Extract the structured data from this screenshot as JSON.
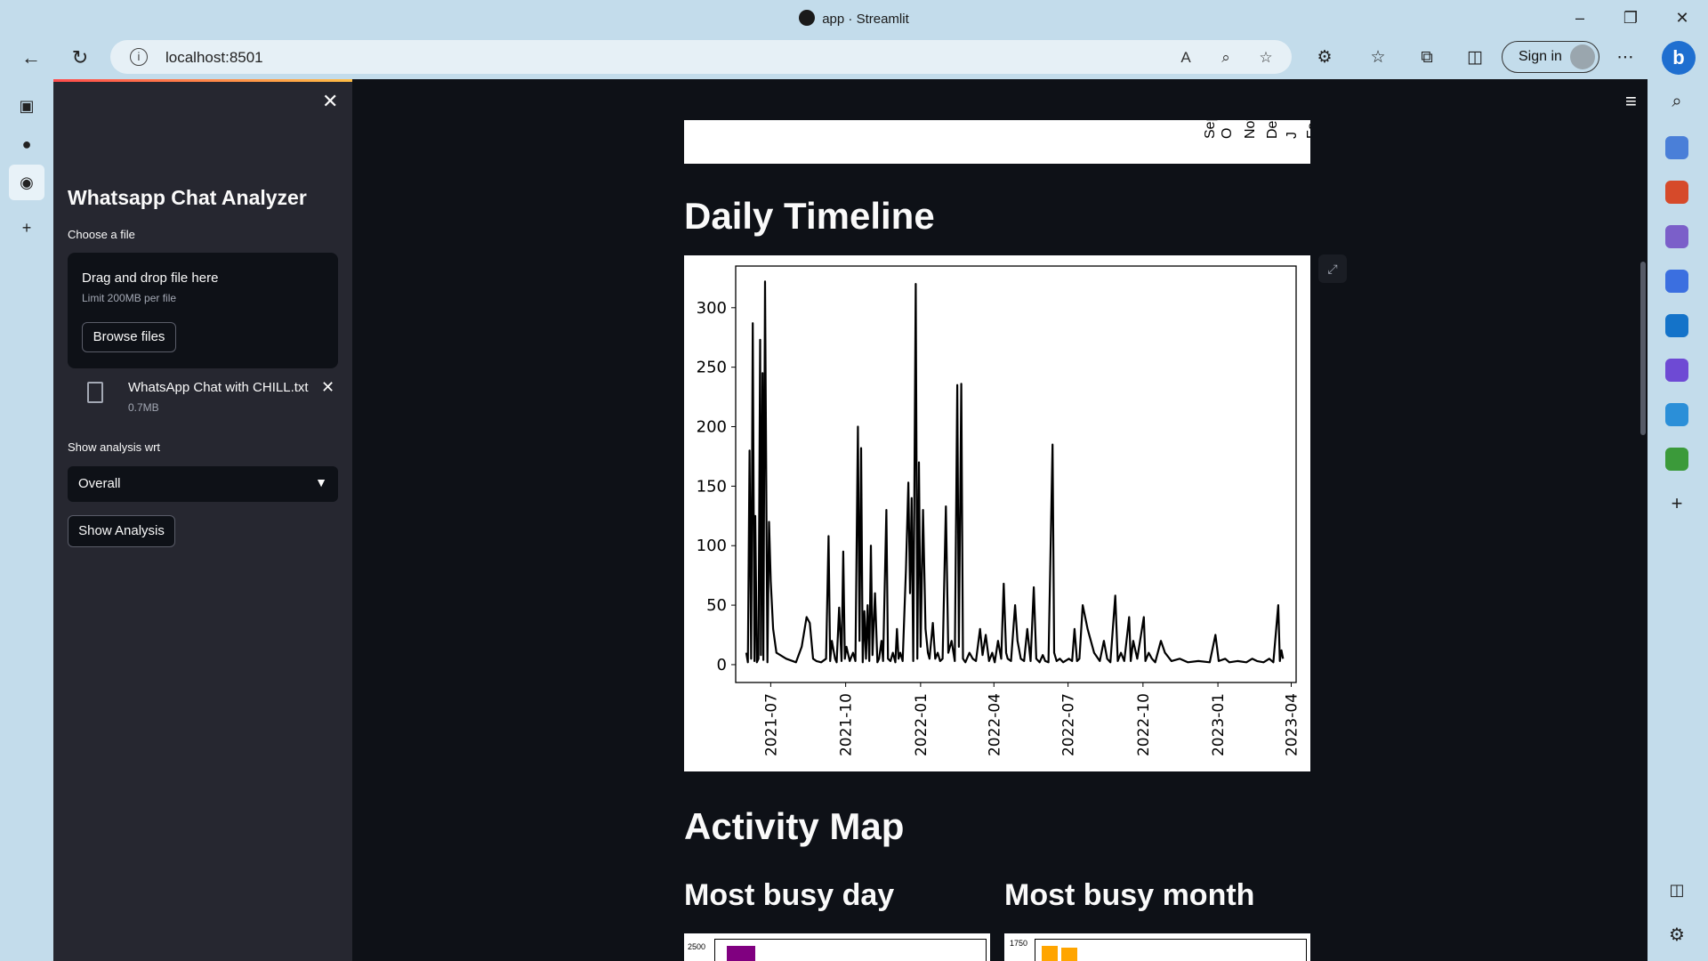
{
  "window": {
    "title": "app · Streamlit"
  },
  "browser": {
    "url": "localhost:8501",
    "signin_label": "Sign in",
    "bing": "b"
  },
  "sidebar": {
    "title": "Whatsapp Chat Analyzer",
    "file_label": "Choose a file",
    "drop_text": "Drag and drop file here",
    "limit_text": "Limit 200MB per file",
    "browse_label": "Browse files",
    "file_name": "WhatsApp Chat with CHILL.txt",
    "file_size": "0.7MB",
    "analysis_label": "Show analysis wrt",
    "analysis_value": "Overall",
    "show_button": "Show Analysis"
  },
  "main": {
    "daily_heading": "Daily Timeline",
    "activity_heading": "Activity Map",
    "busy_day_heading": "Most busy day",
    "busy_month_heading": "Most busy month",
    "monthly_ticks": [
      "Sept",
      "O",
      "Nov",
      "Dec",
      "J",
      "Fe"
    ],
    "busy_day_top_tick": "2500",
    "busy_month_top_tick": "1750"
  },
  "chart_data": [
    {
      "type": "line",
      "title": "",
      "xlabel": "",
      "ylabel": "",
      "ylim": [
        -15,
        335
      ],
      "xlim": [
        "2021-05-19",
        "2023-04-07"
      ],
      "yticks": [
        0,
        50,
        100,
        150,
        200,
        250,
        300
      ],
      "xticks": [
        "2021-07",
        "2021-10",
        "2022-01",
        "2022-04",
        "2022-07",
        "2022-10",
        "2023-01",
        "2023-04"
      ],
      "color": "#000000",
      "series": [
        {
          "points": [
            [
              "2021-06-01",
              10
            ],
            [
              "2021-06-03",
              2
            ],
            [
              "2021-06-05",
              180
            ],
            [
              "2021-06-07",
              5
            ],
            [
              "2021-06-09",
              287
            ],
            [
              "2021-06-11",
              3
            ],
            [
              "2021-06-12",
              125
            ],
            [
              "2021-06-14",
              2
            ],
            [
              "2021-06-16",
              5
            ],
            [
              "2021-06-18",
              273
            ],
            [
              "2021-06-19",
              8
            ],
            [
              "2021-06-21",
              245
            ],
            [
              "2021-06-22",
              4
            ],
            [
              "2021-06-24",
              322
            ],
            [
              "2021-06-26",
              100
            ],
            [
              "2021-06-27",
              2
            ],
            [
              "2021-06-29",
              120
            ],
            [
              "2021-07-01",
              70
            ],
            [
              "2021-07-04",
              30
            ],
            [
              "2021-07-08",
              10
            ],
            [
              "2021-07-20",
              5
            ],
            [
              "2021-08-01",
              2
            ],
            [
              "2021-08-08",
              15
            ],
            [
              "2021-08-14",
              40
            ],
            [
              "2021-08-18",
              35
            ],
            [
              "2021-08-22",
              5
            ],
            [
              "2021-08-26",
              3
            ],
            [
              "2021-09-01",
              2
            ],
            [
              "2021-09-07",
              5
            ],
            [
              "2021-09-10",
              108
            ],
            [
              "2021-09-12",
              3
            ],
            [
              "2021-09-14",
              20
            ],
            [
              "2021-09-18",
              5
            ],
            [
              "2021-09-20",
              2
            ],
            [
              "2021-09-23",
              48
            ],
            [
              "2021-09-26",
              3
            ],
            [
              "2021-09-28",
              95
            ],
            [
              "2021-09-30",
              5
            ],
            [
              "2021-10-02",
              15
            ],
            [
              "2021-10-06",
              3
            ],
            [
              "2021-10-10",
              10
            ],
            [
              "2021-10-13",
              3
            ],
            [
              "2021-10-16",
              200
            ],
            [
              "2021-10-18",
              20
            ],
            [
              "2021-10-20",
              182
            ],
            [
              "2021-10-22",
              2
            ],
            [
              "2021-10-24",
              45
            ],
            [
              "2021-10-26",
              5
            ],
            [
              "2021-10-28",
              50
            ],
            [
              "2021-10-30",
              3
            ],
            [
              "2021-11-01",
              100
            ],
            [
              "2021-11-03",
              8
            ],
            [
              "2021-11-06",
              60
            ],
            [
              "2021-11-09",
              2
            ],
            [
              "2021-11-11",
              5
            ],
            [
              "2021-11-14",
              20
            ],
            [
              "2021-11-16",
              3
            ],
            [
              "2021-11-20",
              130
            ],
            [
              "2021-11-22",
              5
            ],
            [
              "2021-11-25",
              3
            ],
            [
              "2021-11-28",
              10
            ],
            [
              "2021-12-01",
              2
            ],
            [
              "2021-12-03",
              30
            ],
            [
              "2021-12-05",
              5
            ],
            [
              "2021-12-07",
              10
            ],
            [
              "2021-12-10",
              3
            ],
            [
              "2021-12-14",
              80
            ],
            [
              "2021-12-17",
              153
            ],
            [
              "2021-12-19",
              60
            ],
            [
              "2021-12-21",
              140
            ],
            [
              "2021-12-23",
              3
            ],
            [
              "2021-12-26",
              320
            ],
            [
              "2021-12-28",
              5
            ],
            [
              "2021-12-30",
              170
            ],
            [
              "2022-01-01",
              15
            ],
            [
              "2022-01-04",
              130
            ],
            [
              "2022-01-07",
              30
            ],
            [
              "2022-01-10",
              10
            ],
            [
              "2022-01-12",
              5
            ],
            [
              "2022-01-16",
              35
            ],
            [
              "2022-01-19",
              5
            ],
            [
              "2022-01-22",
              10
            ],
            [
              "2022-01-25",
              3
            ],
            [
              "2022-01-28",
              5
            ],
            [
              "2022-02-01",
              133
            ],
            [
              "2022-02-04",
              10
            ],
            [
              "2022-02-08",
              20
            ],
            [
              "2022-02-12",
              3
            ],
            [
              "2022-02-15",
              235
            ],
            [
              "2022-02-17",
              15
            ],
            [
              "2022-02-20",
              236
            ],
            [
              "2022-02-22",
              5
            ],
            [
              "2022-02-25",
              2
            ],
            [
              "2022-03-02",
              10
            ],
            [
              "2022-03-06",
              5
            ],
            [
              "2022-03-10",
              3
            ],
            [
              "2022-03-15",
              30
            ],
            [
              "2022-03-18",
              8
            ],
            [
              "2022-03-22",
              25
            ],
            [
              "2022-03-26",
              3
            ],
            [
              "2022-03-30",
              10
            ],
            [
              "2022-04-02",
              2
            ],
            [
              "2022-04-06",
              20
            ],
            [
              "2022-04-10",
              5
            ],
            [
              "2022-04-13",
              68
            ],
            [
              "2022-04-16",
              10
            ],
            [
              "2022-04-18",
              5
            ],
            [
              "2022-04-22",
              3
            ],
            [
              "2022-04-27",
              50
            ],
            [
              "2022-04-30",
              20
            ],
            [
              "2022-05-04",
              5
            ],
            [
              "2022-05-08",
              3
            ],
            [
              "2022-05-12",
              30
            ],
            [
              "2022-05-16",
              3
            ],
            [
              "2022-05-20",
              65
            ],
            [
              "2022-05-23",
              5
            ],
            [
              "2022-05-27",
              2
            ],
            [
              "2022-05-31",
              8
            ],
            [
              "2022-06-03",
              3
            ],
            [
              "2022-06-07",
              2
            ],
            [
              "2022-06-12",
              185
            ],
            [
              "2022-06-14",
              10
            ],
            [
              "2022-06-17",
              3
            ],
            [
              "2022-06-21",
              5
            ],
            [
              "2022-06-25",
              2
            ],
            [
              "2022-07-02",
              5
            ],
            [
              "2022-07-06",
              3
            ],
            [
              "2022-07-09",
              30
            ],
            [
              "2022-07-12",
              3
            ],
            [
              "2022-07-15",
              5
            ],
            [
              "2022-07-19",
              50
            ],
            [
              "2022-07-25",
              30
            ],
            [
              "2022-08-02",
              10
            ],
            [
              "2022-08-09",
              3
            ],
            [
              "2022-08-14",
              20
            ],
            [
              "2022-08-18",
              5
            ],
            [
              "2022-08-22",
              2
            ],
            [
              "2022-08-28",
              58
            ],
            [
              "2022-08-31",
              3
            ],
            [
              "2022-09-04",
              10
            ],
            [
              "2022-09-08",
              3
            ],
            [
              "2022-09-14",
              40
            ],
            [
              "2022-09-16",
              3
            ],
            [
              "2022-09-19",
              20
            ],
            [
              "2022-09-24",
              5
            ],
            [
              "2022-10-02",
              40
            ],
            [
              "2022-10-04",
              3
            ],
            [
              "2022-10-08",
              10
            ],
            [
              "2022-10-12",
              5
            ],
            [
              "2022-10-16",
              2
            ],
            [
              "2022-10-23",
              20
            ],
            [
              "2022-10-28",
              10
            ],
            [
              "2022-11-05",
              3
            ],
            [
              "2022-11-15",
              5
            ],
            [
              "2022-11-25",
              2
            ],
            [
              "2022-12-08",
              3
            ],
            [
              "2022-12-22",
              2
            ],
            [
              "2022-12-29",
              25
            ],
            [
              "2023-01-02",
              3
            ],
            [
              "2023-01-10",
              5
            ],
            [
              "2023-01-15",
              2
            ],
            [
              "2023-01-25",
              3
            ],
            [
              "2023-02-05",
              2
            ],
            [
              "2023-02-12",
              5
            ],
            [
              "2023-02-18",
              3
            ],
            [
              "2023-02-26",
              2
            ],
            [
              "2023-03-05",
              5
            ],
            [
              "2023-03-10",
              2
            ],
            [
              "2023-03-16",
              50
            ],
            [
              "2023-03-18",
              3
            ],
            [
              "2023-03-20",
              12
            ],
            [
              "2023-03-22",
              5
            ]
          ]
        }
      ]
    }
  ]
}
